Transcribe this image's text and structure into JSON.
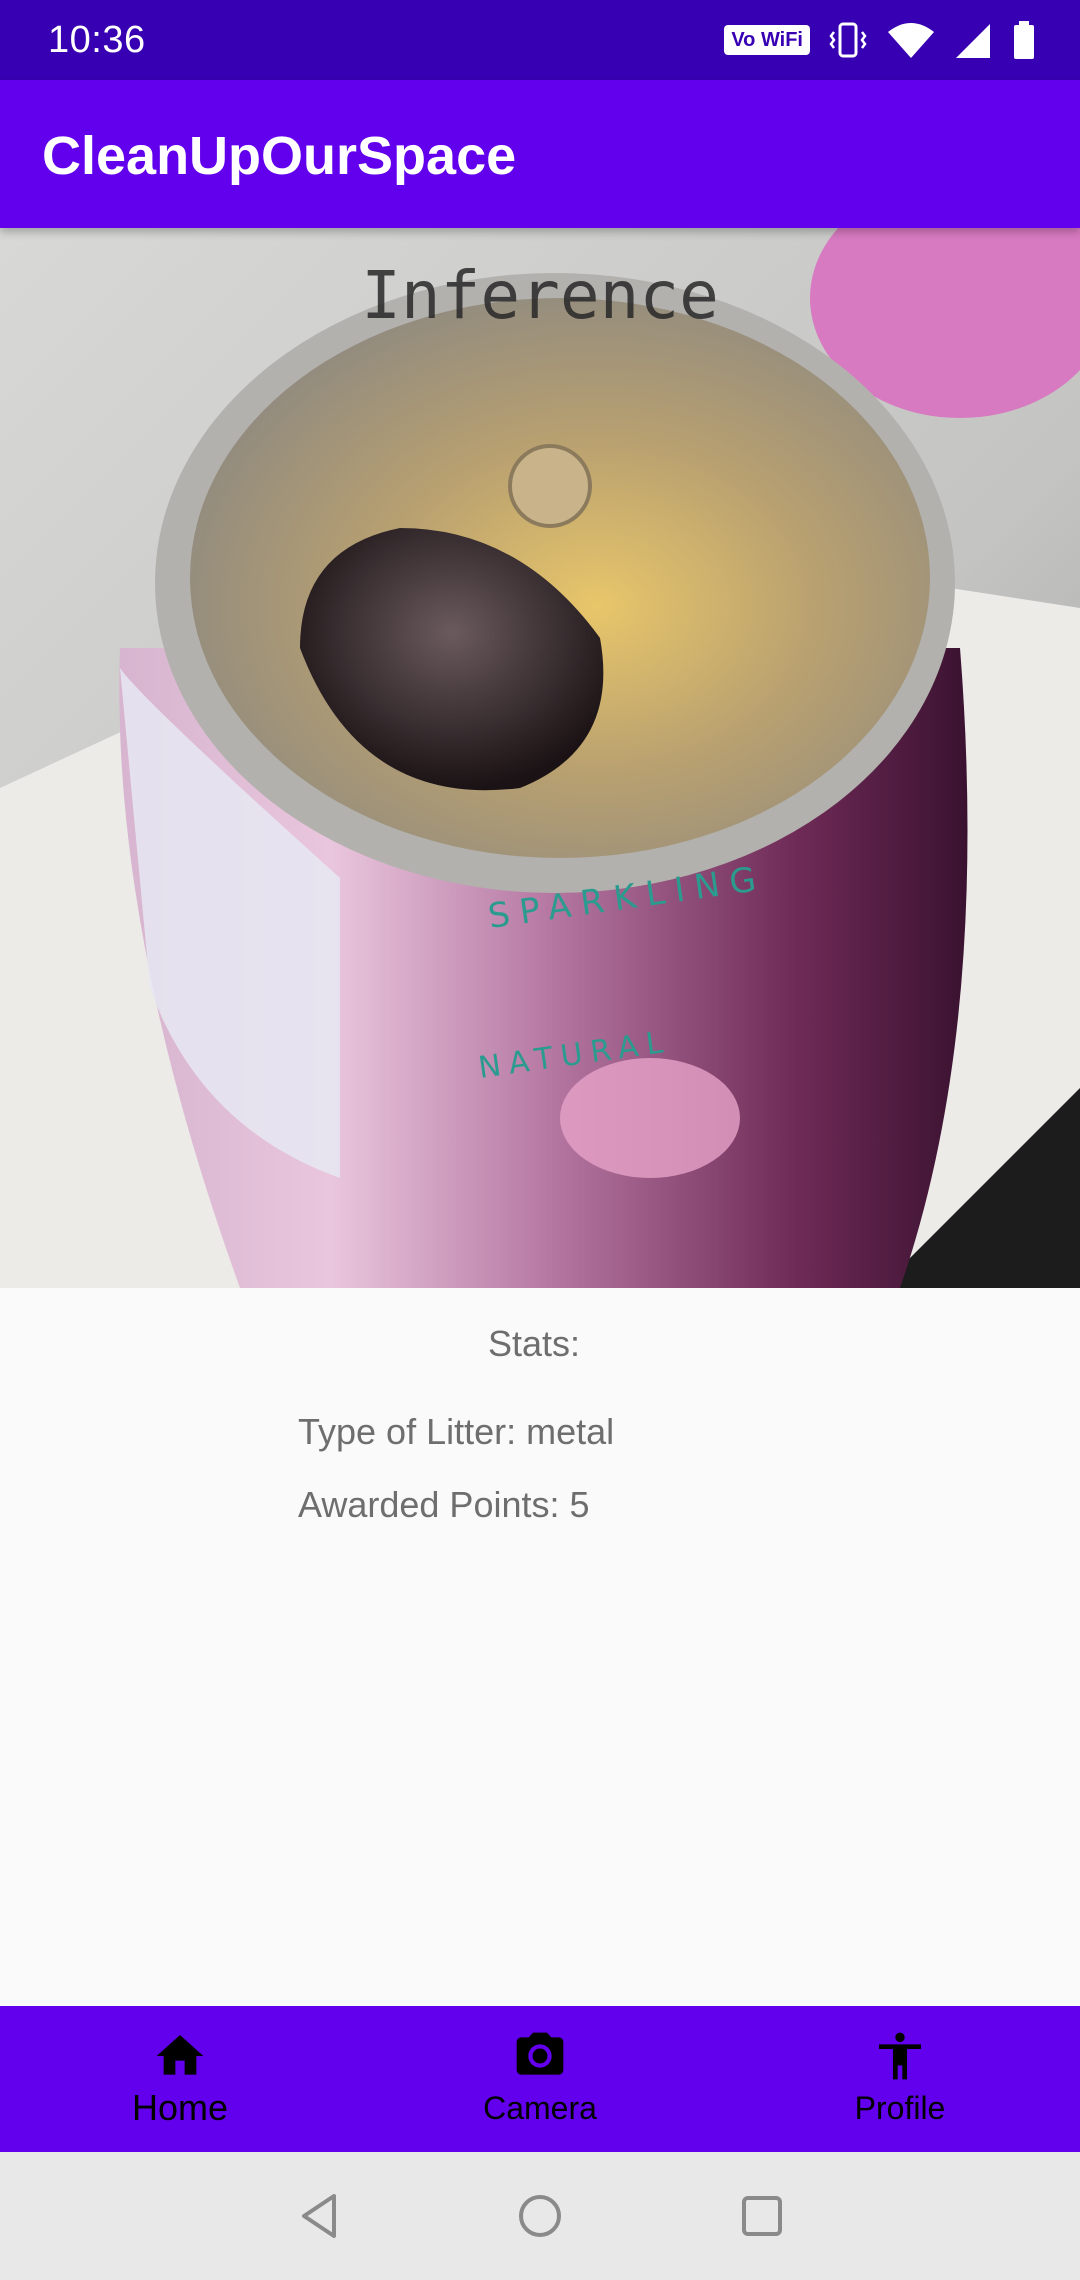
{
  "status_bar": {
    "time": "10:36",
    "vowifi_label": "Vo WiFi",
    "icons": [
      "vowifi-icon",
      "vibrate-icon",
      "wifi-icon",
      "cellular-signal-icon",
      "battery-icon"
    ]
  },
  "app_bar": {
    "title": "CleanUpOurSpace"
  },
  "photo": {
    "overlay_label": "Inference",
    "subject": "opened aluminum can"
  },
  "stats": {
    "title": "Stats:",
    "litter_type": "Type of Litter: metal",
    "points": "Awarded Points: 5"
  },
  "bottom_nav": {
    "items": [
      {
        "label": "Home",
        "icon": "home-icon"
      },
      {
        "label": "Camera",
        "icon": "camera-icon"
      },
      {
        "label": "Profile",
        "icon": "accessibility-person-icon"
      }
    ],
    "selected": "Home"
  },
  "system_nav": {
    "buttons": [
      "back-icon",
      "home-circle-icon",
      "recents-icon"
    ]
  },
  "colors": {
    "status_bar": "#3700b3",
    "primary": "#6200ee",
    "background": "#fafafa",
    "text_secondary": "#6e6e6e",
    "system_nav": "#e8e8e8"
  }
}
